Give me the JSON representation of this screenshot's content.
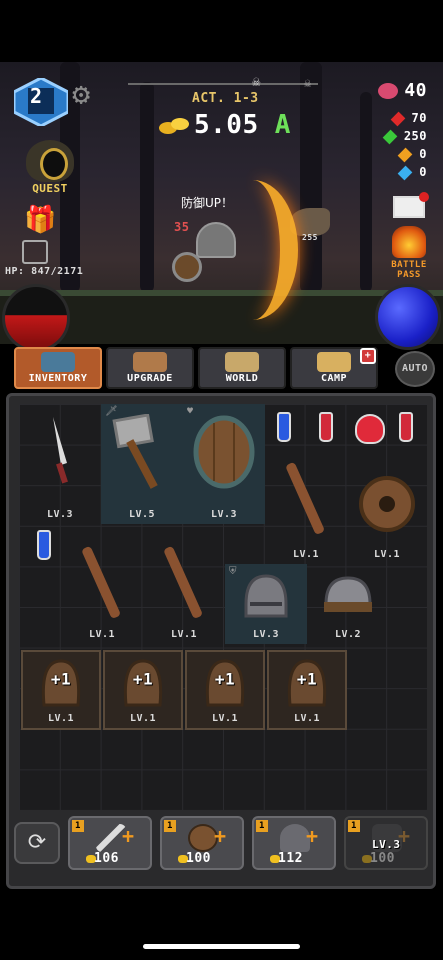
{
  "hud": {
    "player_level": "2",
    "act": "ACT. 1-3",
    "gold": "5.05",
    "gold_suffix": "A",
    "quest_label": "QUEST",
    "hp": "HP: 847/2171",
    "gems": "40",
    "res_red": "70",
    "res_green": "250",
    "res_orange": "0",
    "res_blue": "0",
    "battle_pass": "BATTLE PASS",
    "buff_text": "防御UP！",
    "damage_player": "35",
    "damage_enemy": "255"
  },
  "tabs": [
    {
      "label": "INVENTORY"
    },
    {
      "label": "UPGRADE"
    },
    {
      "label": "WORLD"
    },
    {
      "label": "CAMP"
    }
  ],
  "auto_label": "AUTO",
  "camp_badge": "+",
  "inventory": {
    "row1": [
      "LV.3",
      "LV.5",
      "LV.3"
    ],
    "row2": [
      "LV.1",
      "LV.1"
    ],
    "row3": [
      "LV.1",
      "LV.1",
      "LV.3",
      "LV.2"
    ],
    "capes": [
      "LV.1",
      "LV.1",
      "LV.1",
      "LV.1"
    ],
    "cape_plus": "+1"
  },
  "crafts": [
    {
      "level": "1",
      "cost": "106"
    },
    {
      "level": "1",
      "cost": "100"
    },
    {
      "level": "1",
      "cost": "112"
    },
    {
      "level": "1",
      "cost": "100",
      "requirement": "LV.3"
    }
  ],
  "colors": {
    "accent_green": "#6ee05a",
    "hp_red": "#c21818",
    "mp_blue": "#1a20c8",
    "tab_active": "#b25a2a"
  }
}
